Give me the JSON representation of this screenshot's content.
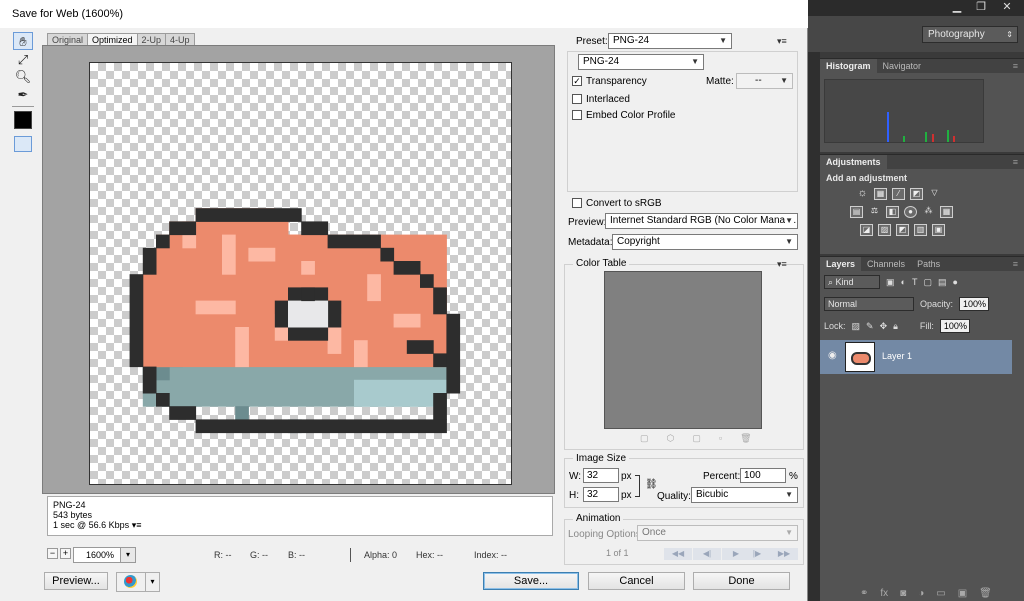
{
  "dialog": {
    "title": "Save for Web (1600%)",
    "tabs": [
      "Original",
      "Optimized",
      "2-Up",
      "4-Up"
    ],
    "info": {
      "format": "PNG-24",
      "size": "543 bytes",
      "time": "1 sec @ 56.6 Kbps"
    },
    "status": {
      "zoom": "1600%",
      "r": "R: --",
      "g": "G: --",
      "b": "B: --",
      "alpha": "Alpha: 0",
      "hex": "Hex: --",
      "index": "Index: --"
    },
    "buttons": {
      "preview": "Preview...",
      "save": "Save...",
      "cancel": "Cancel",
      "done": "Done"
    }
  },
  "settings": {
    "preset_label": "Preset:",
    "preset_value": "PNG-24",
    "format_value": "PNG-24",
    "transparency": "Transparency",
    "transparency_checked": "✓",
    "matte_label": "Matte:",
    "matte_value": "--",
    "interlaced": "Interlaced",
    "embed_profile": "Embed Color Profile",
    "convert_srgb": "Convert to sRGB",
    "preview_label": "Preview:",
    "preview_value": "Internet Standard RGB (No Color Manag...",
    "metadata_label": "Metadata:",
    "metadata_value": "Copyright",
    "color_table": "Color Table",
    "image_size": "Image Size",
    "w_label": "W:",
    "w_value": "32",
    "h_label": "H:",
    "h_value": "32",
    "px": "px",
    "percent_label": "Percent:",
    "percent_value": "100",
    "percent_unit": "%",
    "quality_label": "Quality:",
    "quality_value": "Bicubic",
    "animation": "Animation",
    "looping_label": "Looping Options:",
    "looping_value": "Once",
    "frame_counter": "1 of 1"
  },
  "photoshop": {
    "workspace": "Photography",
    "histogram_tab": "Histogram",
    "navigator_tab": "Navigator",
    "adjustments_tab": "Adjustments",
    "add_adjustment": "Add an adjustment",
    "layers_tab": "Layers",
    "channels_tab": "Channels",
    "paths_tab": "Paths",
    "kind": "Kind",
    "blend_mode": "Normal",
    "opacity_label": "Opacity:",
    "opacity_value": "100%",
    "lock_label": "Lock:",
    "fill_label": "Fill:",
    "fill_value": "100%",
    "layer_name": "Layer 1"
  },
  "colors": {
    "meat": "#ec8a6c",
    "meat_light": "#fdb8a3",
    "outline": "#2d2d2d",
    "bone": "#e8e8ea",
    "plate": "#89a8a9",
    "plate_light": "#a8cacd",
    "plate_dark": "#6c8c8f"
  }
}
